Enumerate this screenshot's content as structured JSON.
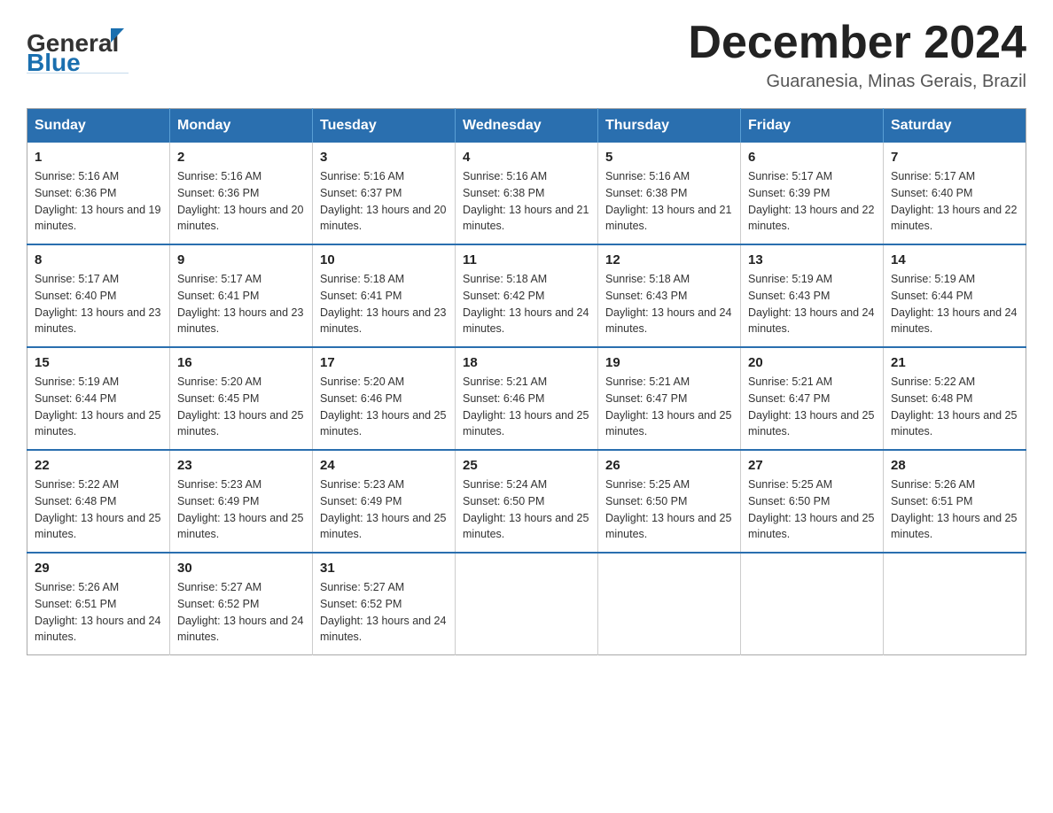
{
  "header": {
    "logo": {
      "general": "General",
      "blue": "Blue"
    },
    "title": "December 2024",
    "location": "Guaranesia, Minas Gerais, Brazil"
  },
  "calendar": {
    "days_of_week": [
      "Sunday",
      "Monday",
      "Tuesday",
      "Wednesday",
      "Thursday",
      "Friday",
      "Saturday"
    ],
    "weeks": [
      [
        {
          "day": "1",
          "sunrise": "Sunrise: 5:16 AM",
          "sunset": "Sunset: 6:36 PM",
          "daylight": "Daylight: 13 hours and 19 minutes."
        },
        {
          "day": "2",
          "sunrise": "Sunrise: 5:16 AM",
          "sunset": "Sunset: 6:36 PM",
          "daylight": "Daylight: 13 hours and 20 minutes."
        },
        {
          "day": "3",
          "sunrise": "Sunrise: 5:16 AM",
          "sunset": "Sunset: 6:37 PM",
          "daylight": "Daylight: 13 hours and 20 minutes."
        },
        {
          "day": "4",
          "sunrise": "Sunrise: 5:16 AM",
          "sunset": "Sunset: 6:38 PM",
          "daylight": "Daylight: 13 hours and 21 minutes."
        },
        {
          "day": "5",
          "sunrise": "Sunrise: 5:16 AM",
          "sunset": "Sunset: 6:38 PM",
          "daylight": "Daylight: 13 hours and 21 minutes."
        },
        {
          "day": "6",
          "sunrise": "Sunrise: 5:17 AM",
          "sunset": "Sunset: 6:39 PM",
          "daylight": "Daylight: 13 hours and 22 minutes."
        },
        {
          "day": "7",
          "sunrise": "Sunrise: 5:17 AM",
          "sunset": "Sunset: 6:40 PM",
          "daylight": "Daylight: 13 hours and 22 minutes."
        }
      ],
      [
        {
          "day": "8",
          "sunrise": "Sunrise: 5:17 AM",
          "sunset": "Sunset: 6:40 PM",
          "daylight": "Daylight: 13 hours and 23 minutes."
        },
        {
          "day": "9",
          "sunrise": "Sunrise: 5:17 AM",
          "sunset": "Sunset: 6:41 PM",
          "daylight": "Daylight: 13 hours and 23 minutes."
        },
        {
          "day": "10",
          "sunrise": "Sunrise: 5:18 AM",
          "sunset": "Sunset: 6:41 PM",
          "daylight": "Daylight: 13 hours and 23 minutes."
        },
        {
          "day": "11",
          "sunrise": "Sunrise: 5:18 AM",
          "sunset": "Sunset: 6:42 PM",
          "daylight": "Daylight: 13 hours and 24 minutes."
        },
        {
          "day": "12",
          "sunrise": "Sunrise: 5:18 AM",
          "sunset": "Sunset: 6:43 PM",
          "daylight": "Daylight: 13 hours and 24 minutes."
        },
        {
          "day": "13",
          "sunrise": "Sunrise: 5:19 AM",
          "sunset": "Sunset: 6:43 PM",
          "daylight": "Daylight: 13 hours and 24 minutes."
        },
        {
          "day": "14",
          "sunrise": "Sunrise: 5:19 AM",
          "sunset": "Sunset: 6:44 PM",
          "daylight": "Daylight: 13 hours and 24 minutes."
        }
      ],
      [
        {
          "day": "15",
          "sunrise": "Sunrise: 5:19 AM",
          "sunset": "Sunset: 6:44 PM",
          "daylight": "Daylight: 13 hours and 25 minutes."
        },
        {
          "day": "16",
          "sunrise": "Sunrise: 5:20 AM",
          "sunset": "Sunset: 6:45 PM",
          "daylight": "Daylight: 13 hours and 25 minutes."
        },
        {
          "day": "17",
          "sunrise": "Sunrise: 5:20 AM",
          "sunset": "Sunset: 6:46 PM",
          "daylight": "Daylight: 13 hours and 25 minutes."
        },
        {
          "day": "18",
          "sunrise": "Sunrise: 5:21 AM",
          "sunset": "Sunset: 6:46 PM",
          "daylight": "Daylight: 13 hours and 25 minutes."
        },
        {
          "day": "19",
          "sunrise": "Sunrise: 5:21 AM",
          "sunset": "Sunset: 6:47 PM",
          "daylight": "Daylight: 13 hours and 25 minutes."
        },
        {
          "day": "20",
          "sunrise": "Sunrise: 5:21 AM",
          "sunset": "Sunset: 6:47 PM",
          "daylight": "Daylight: 13 hours and 25 minutes."
        },
        {
          "day": "21",
          "sunrise": "Sunrise: 5:22 AM",
          "sunset": "Sunset: 6:48 PM",
          "daylight": "Daylight: 13 hours and 25 minutes."
        }
      ],
      [
        {
          "day": "22",
          "sunrise": "Sunrise: 5:22 AM",
          "sunset": "Sunset: 6:48 PM",
          "daylight": "Daylight: 13 hours and 25 minutes."
        },
        {
          "day": "23",
          "sunrise": "Sunrise: 5:23 AM",
          "sunset": "Sunset: 6:49 PM",
          "daylight": "Daylight: 13 hours and 25 minutes."
        },
        {
          "day": "24",
          "sunrise": "Sunrise: 5:23 AM",
          "sunset": "Sunset: 6:49 PM",
          "daylight": "Daylight: 13 hours and 25 minutes."
        },
        {
          "day": "25",
          "sunrise": "Sunrise: 5:24 AM",
          "sunset": "Sunset: 6:50 PM",
          "daylight": "Daylight: 13 hours and 25 minutes."
        },
        {
          "day": "26",
          "sunrise": "Sunrise: 5:25 AM",
          "sunset": "Sunset: 6:50 PM",
          "daylight": "Daylight: 13 hours and 25 minutes."
        },
        {
          "day": "27",
          "sunrise": "Sunrise: 5:25 AM",
          "sunset": "Sunset: 6:50 PM",
          "daylight": "Daylight: 13 hours and 25 minutes."
        },
        {
          "day": "28",
          "sunrise": "Sunrise: 5:26 AM",
          "sunset": "Sunset: 6:51 PM",
          "daylight": "Daylight: 13 hours and 25 minutes."
        }
      ],
      [
        {
          "day": "29",
          "sunrise": "Sunrise: 5:26 AM",
          "sunset": "Sunset: 6:51 PM",
          "daylight": "Daylight: 13 hours and 24 minutes."
        },
        {
          "day": "30",
          "sunrise": "Sunrise: 5:27 AM",
          "sunset": "Sunset: 6:52 PM",
          "daylight": "Daylight: 13 hours and 24 minutes."
        },
        {
          "day": "31",
          "sunrise": "Sunrise: 5:27 AM",
          "sunset": "Sunset: 6:52 PM",
          "daylight": "Daylight: 13 hours and 24 minutes."
        },
        null,
        null,
        null,
        null
      ]
    ]
  }
}
